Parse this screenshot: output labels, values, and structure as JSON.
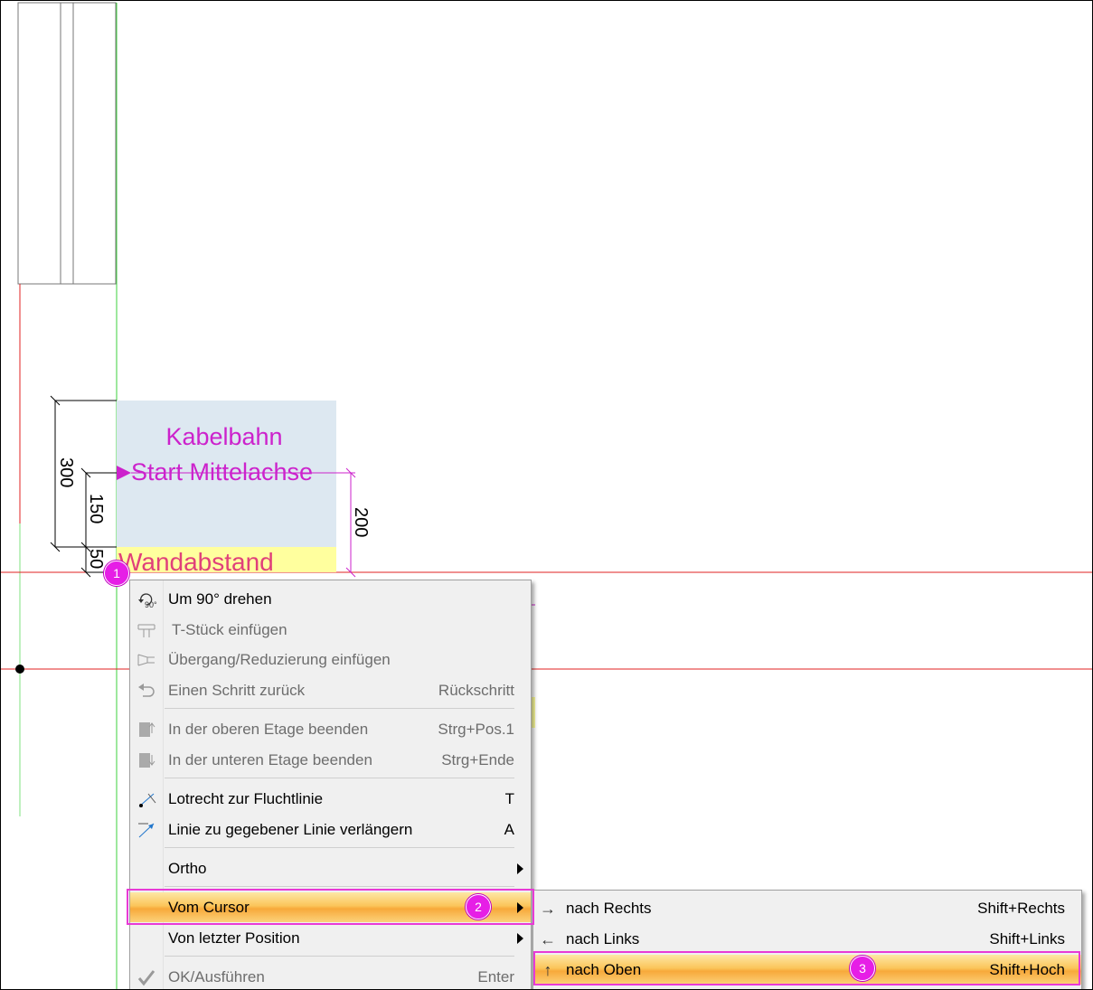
{
  "drawing": {
    "label_line1": "Kabelbahn",
    "label_line2": "Start Mittelachse",
    "label_wall": "Wandabstand",
    "dim_300": "300",
    "dim_150": "150",
    "dim_50": "50",
    "dim_200": "200"
  },
  "context_menu": {
    "items": [
      {
        "label": "Um 90° drehen",
        "shortcut": "",
        "icon": "rotate-90-icon"
      },
      {
        "label": "T-Stück einfügen",
        "shortcut": "",
        "icon": "t-piece-icon"
      },
      {
        "label": "Übergang/Reduzierung einfügen",
        "shortcut": "",
        "icon": "reducer-icon"
      },
      {
        "label": "Einen Schritt zurück",
        "shortcut": "Rückschritt",
        "icon": "undo-icon"
      },
      {
        "label": "In der oberen Etage beenden",
        "shortcut": "Strg+Pos.1",
        "icon": "upper-floor-icon"
      },
      {
        "label": "In der unteren Etage beenden",
        "shortcut": "Strg+Ende",
        "icon": "lower-floor-icon"
      },
      {
        "label": "Lotrecht zur Fluchtlinie",
        "shortcut": "T",
        "icon": "perpendicular-icon"
      },
      {
        "label": "Linie zu gegebener Linie verlängern",
        "shortcut": "A",
        "icon": "extend-line-icon"
      },
      {
        "label": "Ortho",
        "shortcut": "",
        "icon": ""
      },
      {
        "label": "Vom Cursor",
        "shortcut": "",
        "icon": ""
      },
      {
        "label": "Von letzter Position",
        "shortcut": "",
        "icon": ""
      },
      {
        "label": "OK/Ausführen",
        "shortcut": "Enter",
        "icon": "checkmark-icon"
      }
    ]
  },
  "submenu": {
    "items": [
      {
        "label": "nach Rechts",
        "shortcut": "Shift+Rechts",
        "icon": "arrow-right-icon"
      },
      {
        "label": "nach Links",
        "shortcut": "Shift+Links",
        "icon": "arrow-left-icon"
      },
      {
        "label": "nach Oben",
        "shortcut": "Shift+Hoch",
        "icon": "arrow-up-icon"
      }
    ]
  },
  "badges": [
    "1",
    "2",
    "3"
  ],
  "colors": {
    "highlight": "#f7a93a",
    "marker": "#e83ad6",
    "magenta_text": "#cc22cc",
    "red_line": "#e02020",
    "green_line": "#3cd23c",
    "blue_fill": "#dde8f1",
    "yellow_fill": "#ffff9e"
  }
}
